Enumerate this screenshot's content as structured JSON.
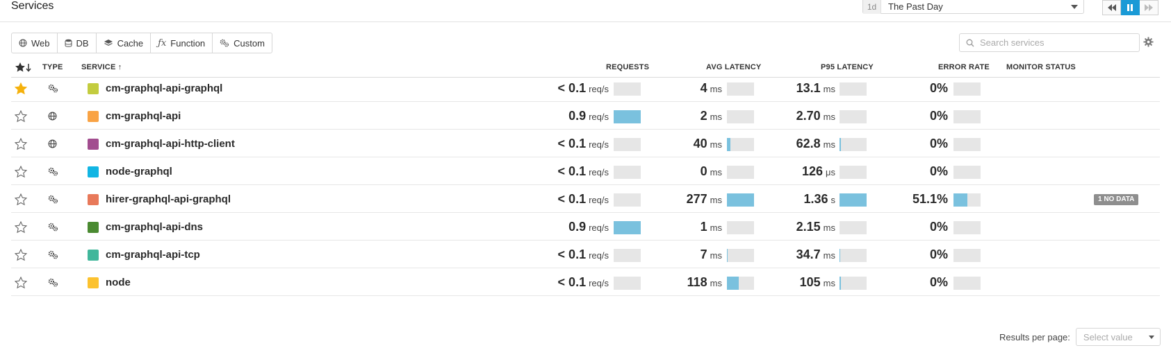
{
  "page": {
    "title": "Services"
  },
  "time": {
    "badge": "1d",
    "label": "The Past Day"
  },
  "filters": [
    {
      "label": "Web",
      "icon": "globe-icon"
    },
    {
      "label": "DB",
      "icon": "database-icon"
    },
    {
      "label": "Cache",
      "icon": "layers-icon"
    },
    {
      "label": "Function",
      "icon": "function-icon"
    },
    {
      "label": "Custom",
      "icon": "gears-icon"
    }
  ],
  "search": {
    "placeholder": "Search services"
  },
  "table": {
    "headers": {
      "type": "TYPE",
      "service": "SERVICE ↑",
      "requests": "REQUESTS",
      "avg_latency": "AVG LATENCY",
      "p95_latency": "P95 LATENCY",
      "error_rate": "ERROR RATE",
      "monitor_status": "MONITOR STATUS"
    },
    "rows": [
      {
        "starred": true,
        "type": "custom",
        "color": "#c3cc3f",
        "name": "cm-graphql-api-graphql",
        "req": "< 0.1",
        "req_unit": "req/s",
        "req_fill": 0,
        "avg": "4",
        "avg_unit": "ms",
        "avg_fill": 0,
        "p95": "13.1",
        "p95_unit": "ms",
        "p95_fill": 0,
        "err": "0%",
        "err_fill": 0,
        "status": ""
      },
      {
        "starred": false,
        "type": "web",
        "color": "#f9a344",
        "name": "cm-graphql-api",
        "req": "0.9",
        "req_unit": "req/s",
        "req_fill": 1.0,
        "avg": "2",
        "avg_unit": "ms",
        "avg_fill": 0,
        "p95": "2.70",
        "p95_unit": "ms",
        "p95_fill": 0,
        "err": "0%",
        "err_fill": 0,
        "status": ""
      },
      {
        "starred": false,
        "type": "web",
        "color": "#a24d8f",
        "name": "cm-graphql-api-http-client",
        "req": "< 0.1",
        "req_unit": "req/s",
        "req_fill": 0,
        "avg": "40",
        "avg_unit": "ms",
        "avg_fill": 0.14,
        "p95": "62.8",
        "p95_unit": "ms",
        "p95_fill": 0.05,
        "err": "0%",
        "err_fill": 0,
        "status": ""
      },
      {
        "starred": false,
        "type": "custom",
        "color": "#12b5e3",
        "name": "node-graphql",
        "req": "< 0.1",
        "req_unit": "req/s",
        "req_fill": 0,
        "avg": "0",
        "avg_unit": "ms",
        "avg_fill": 0,
        "p95": "126",
        "p95_unit": "μs",
        "p95_fill": 0,
        "err": "0%",
        "err_fill": 0,
        "status": ""
      },
      {
        "starred": false,
        "type": "custom",
        "color": "#e8795a",
        "name": "hirer-graphql-api-graphql",
        "req": "< 0.1",
        "req_unit": "req/s",
        "req_fill": 0,
        "avg": "277",
        "avg_unit": "ms",
        "avg_fill": 1.0,
        "p95": "1.36",
        "p95_unit": "s",
        "p95_fill": 1.0,
        "err": "51.1%",
        "err_fill": 0.51,
        "status": "1 NO DATA"
      },
      {
        "starred": false,
        "type": "custom",
        "color": "#4a8a31",
        "name": "cm-graphql-api-dns",
        "req": "0.9",
        "req_unit": "req/s",
        "req_fill": 1.0,
        "avg": "1",
        "avg_unit": "ms",
        "avg_fill": 0,
        "p95": "2.15",
        "p95_unit": "ms",
        "p95_fill": 0,
        "err": "0%",
        "err_fill": 0,
        "status": ""
      },
      {
        "starred": false,
        "type": "custom",
        "color": "#41b79b",
        "name": "cm-graphql-api-tcp",
        "req": "< 0.1",
        "req_unit": "req/s",
        "req_fill": 0,
        "avg": "7",
        "avg_unit": "ms",
        "avg_fill": 0.03,
        "p95": "34.7",
        "p95_unit": "ms",
        "p95_fill": 0.03,
        "err": "0%",
        "err_fill": 0,
        "status": ""
      },
      {
        "starred": false,
        "type": "custom",
        "color": "#fcc22f",
        "name": "node",
        "req": "< 0.1",
        "req_unit": "req/s",
        "req_fill": 0,
        "avg": "118",
        "avg_unit": "ms",
        "avg_fill": 0.43,
        "p95": "105",
        "p95_unit": "ms",
        "p95_fill": 0.05,
        "err": "0%",
        "err_fill": 0,
        "status": ""
      }
    ]
  },
  "footer": {
    "results_label": "Results per page:",
    "select_placeholder": "Select value"
  },
  "colors": {
    "bar_fill": "#7ac1de",
    "bar_track": "#e6e6e6",
    "star_active": "#f5b10c",
    "accent": "#1a9ad6"
  }
}
